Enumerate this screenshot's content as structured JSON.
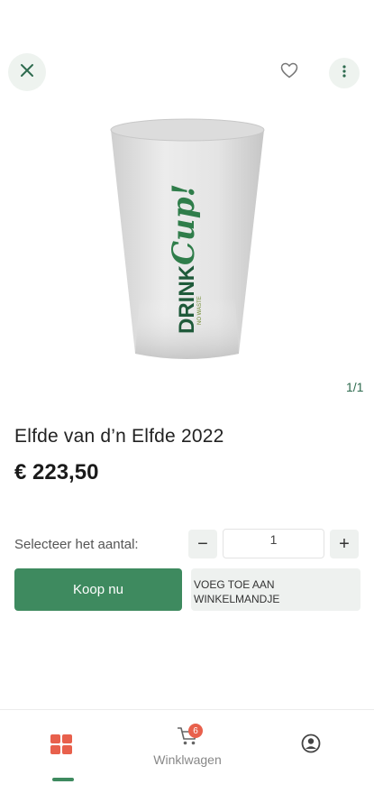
{
  "header": {
    "close_icon": "close-icon",
    "favorite_icon": "heart-icon",
    "more_icon": "more-vertical-icon"
  },
  "product": {
    "image_icon": "drink-cup-image",
    "pager": "1/1",
    "title": "Elfde van d’n Elfde 2022",
    "price": "€ 223,50"
  },
  "quantity": {
    "label": "Selecteer het aantal:",
    "minus": "−",
    "value": "1",
    "plus": "+"
  },
  "actions": {
    "buy_now": "Koop nu",
    "add_to_cart_line1": "VOEG TOE AAN",
    "add_to_cart_line2": "WINKELMANDJE"
  },
  "bottom_nav": {
    "cart_label": "Winklwagen",
    "cart_badge": "6"
  },
  "colors": {
    "accent": "#3e8a5f",
    "badge": "#e8604c",
    "home_icon": "#e8604c"
  }
}
